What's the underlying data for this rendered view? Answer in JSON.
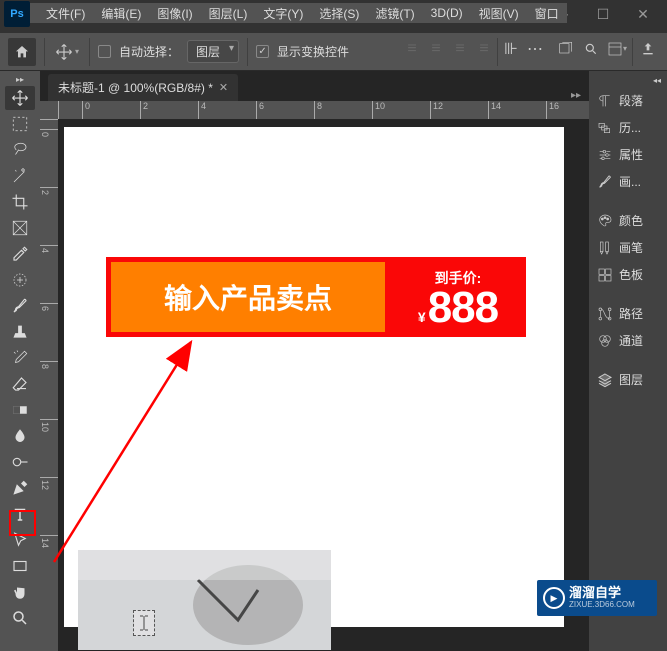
{
  "menubar": {
    "file": "文件(F)",
    "edit": "编辑(E)",
    "image": "图像(I)",
    "layer": "图层(L)",
    "type": "文字(Y)",
    "select": "选择(S)",
    "filter": "滤镜(T)",
    "threed": "3D(D)",
    "view": "视图(V)",
    "window": "窗口"
  },
  "optbar": {
    "auto_select": "自动选择：",
    "dropdown_val": "图层",
    "show_transform": "显示变换控件"
  },
  "doc": {
    "tab_title": "未标题-1 @ 100%(RGB/8#) *"
  },
  "ruler_h": [
    "0",
    "2",
    "4",
    "6",
    "8",
    "10",
    "12",
    "14",
    "16"
  ],
  "ruler_v": [
    "0",
    "2",
    "4",
    "6",
    "8",
    "10",
    "12",
    "14"
  ],
  "banner": {
    "left_text": "输入产品卖点",
    "price_label": "到手价:",
    "currency": "¥",
    "price": "888"
  },
  "panels": {
    "paragraph": "段落",
    "history": "历...",
    "properties": "属性",
    "brushes": "画...",
    "color": "颜色",
    "brushset": "画笔",
    "swatches": "色板",
    "paths": "路径",
    "channels": "通道",
    "layers": "图层"
  },
  "watermark": {
    "title": "溜溜自学",
    "sub": "ZIXUE.3D66.COM"
  }
}
